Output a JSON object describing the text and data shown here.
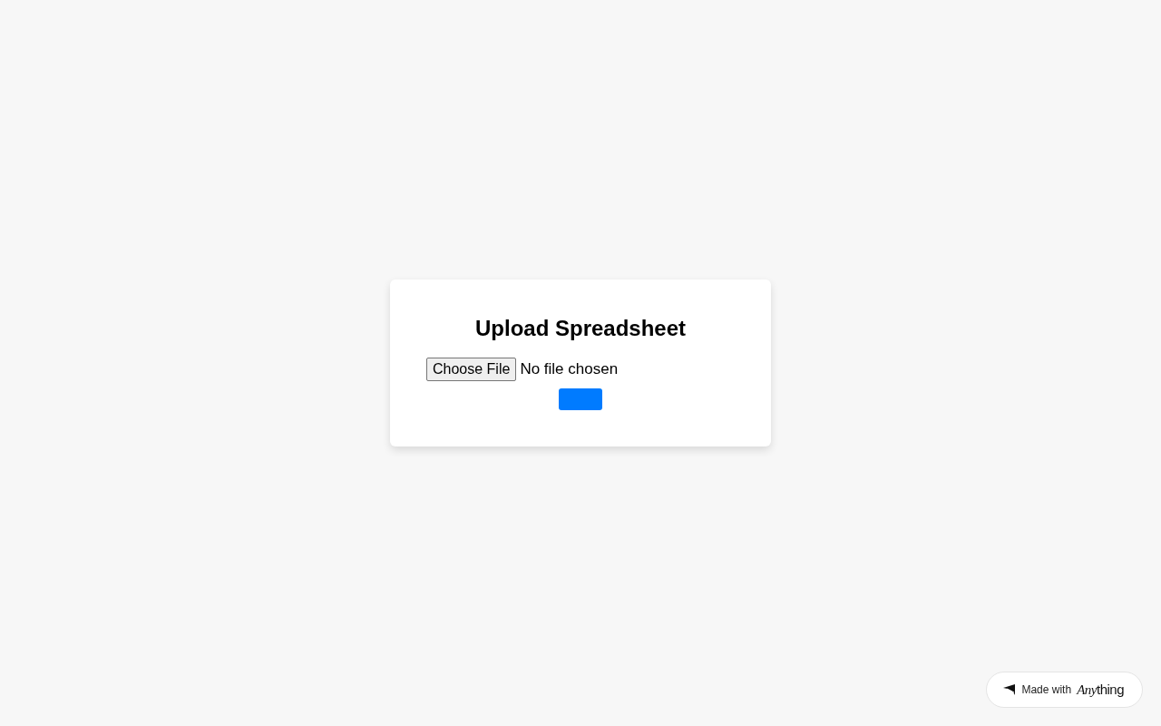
{
  "card": {
    "title": "Upload Spreadsheet",
    "file_input": {
      "button": "Choose File",
      "status": "No file chosen"
    }
  },
  "badge": {
    "label": "Made with",
    "brand": {
      "italic_part": "Any",
      "rest": "thing"
    }
  }
}
